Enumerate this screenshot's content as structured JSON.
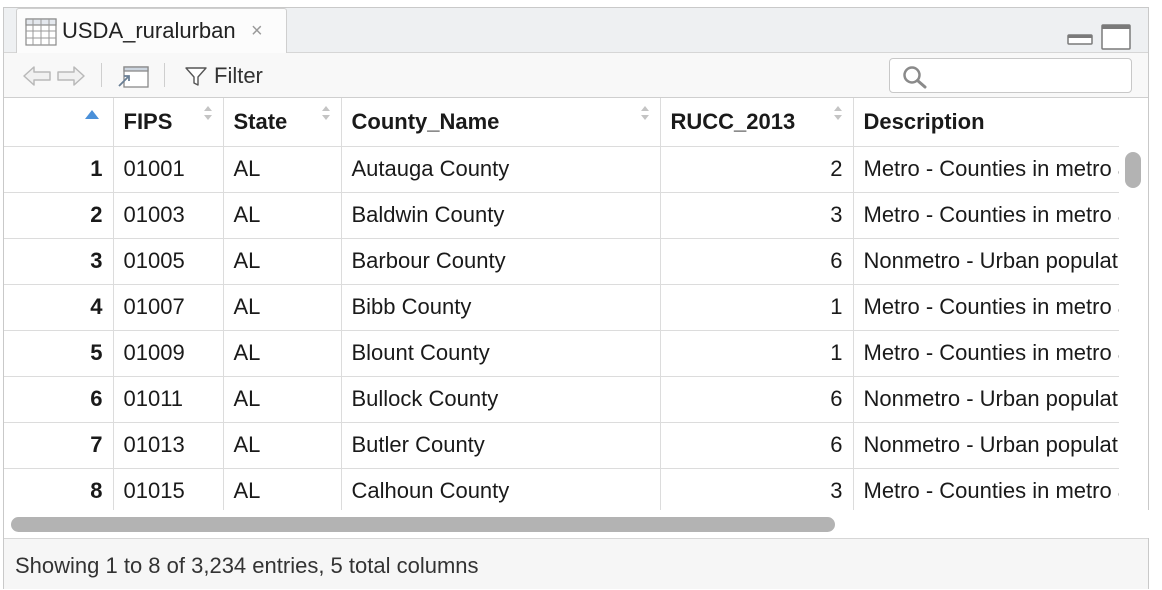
{
  "tab": {
    "title": "USDA_ruralurban",
    "close_glyph": "×",
    "icon": "table-grid-icon"
  },
  "toolbar": {
    "back_icon": "arrow-left-icon",
    "forward_icon": "arrow-right-icon",
    "popout_icon": "popout-window-icon",
    "filter_label": "Filter",
    "filter_icon": "funnel-icon",
    "search_placeholder": "",
    "search_value": ""
  },
  "table": {
    "columns": [
      "FIPS",
      "State",
      "County_Name",
      "RUCC_2013",
      "Description"
    ],
    "rows": [
      {
        "n": "1",
        "fips": "01001",
        "state": "AL",
        "county": "Autauga County",
        "rucc": "2",
        "desc": "Metro - Counties in metro areas"
      },
      {
        "n": "2",
        "fips": "01003",
        "state": "AL",
        "county": "Baldwin County",
        "rucc": "3",
        "desc": "Metro - Counties in metro areas"
      },
      {
        "n": "3",
        "fips": "01005",
        "state": "AL",
        "county": "Barbour County",
        "rucc": "6",
        "desc": "Nonmetro - Urban population"
      },
      {
        "n": "4",
        "fips": "01007",
        "state": "AL",
        "county": "Bibb County",
        "rucc": "1",
        "desc": "Metro - Counties in metro areas"
      },
      {
        "n": "5",
        "fips": "01009",
        "state": "AL",
        "county": "Blount County",
        "rucc": "1",
        "desc": "Metro - Counties in metro areas"
      },
      {
        "n": "6",
        "fips": "01011",
        "state": "AL",
        "county": "Bullock County",
        "rucc": "6",
        "desc": "Nonmetro - Urban population"
      },
      {
        "n": "7",
        "fips": "01013",
        "state": "AL",
        "county": "Butler County",
        "rucc": "6",
        "desc": "Nonmetro - Urban population"
      },
      {
        "n": "8",
        "fips": "01015",
        "state": "AL",
        "county": "Calhoun County",
        "rucc": "3",
        "desc": "Metro - Counties in metro areas"
      }
    ]
  },
  "status": {
    "text": "Showing 1 to 8 of 3,234 entries, 5 total columns"
  },
  "colors": {
    "accent": "#4a90d9",
    "border": "#dcdcdc",
    "scrollbar": "#b3b3b3"
  }
}
